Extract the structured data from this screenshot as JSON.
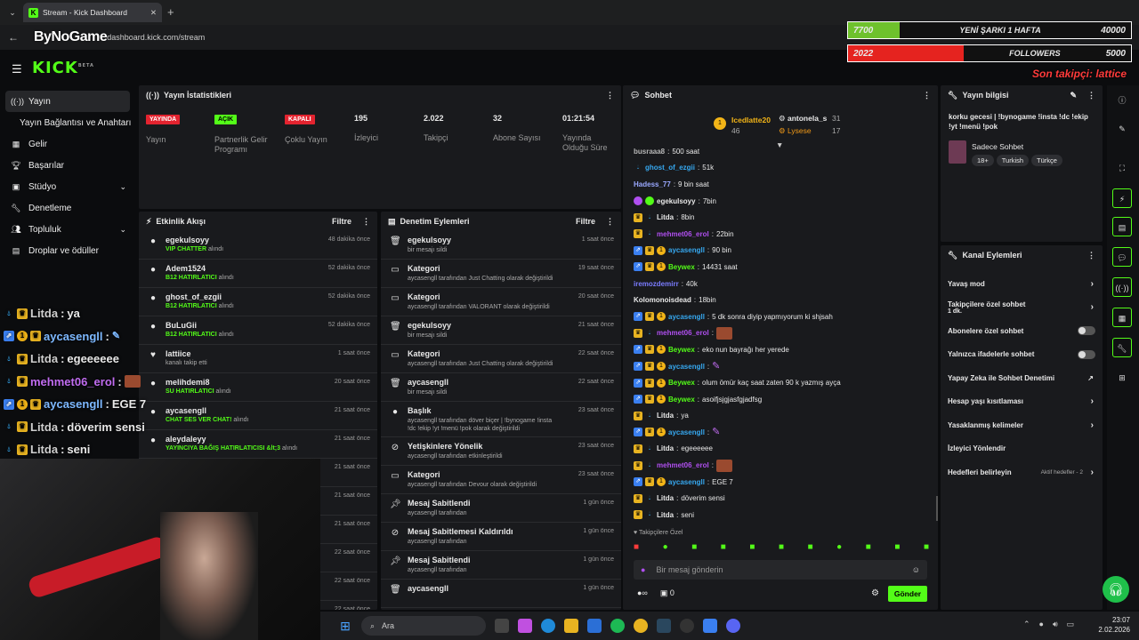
{
  "browser": {
    "tab_title": "Stream - Kick Dashboard",
    "url": "dashboard.kick.com/stream",
    "overlay_logo": "ByNoGame"
  },
  "overlay": {
    "bar1": {
      "current": "7700",
      "label": "YENİ ŞARKI 1 HAFTA",
      "goal": "40000"
    },
    "bar2": {
      "current": "2022",
      "label": "FOLLOWERS",
      "goal": "5000"
    },
    "last_follower": "Son takipçi: lattice"
  },
  "kick_logo": "KICK",
  "sidebar": {
    "items": [
      {
        "label": "Yayın",
        "icon": "broadcast-icon"
      },
      {
        "label": "Yayın Bağlantısı ve Anahtarı",
        "icon": ""
      },
      {
        "label": "Gelir",
        "icon": "chart-icon"
      },
      {
        "label": "Başarılar",
        "icon": "trophy-icon"
      },
      {
        "label": "Stüdyo",
        "icon": "grid-icon"
      },
      {
        "label": "Denetleme",
        "icon": "wrench-icon"
      },
      {
        "label": "Topluluk",
        "icon": "people-icon"
      },
      {
        "label": "Droplar ve ödüller",
        "icon": "gift-icon"
      }
    ]
  },
  "stats": {
    "title": "Yayın İstatistikleri",
    "items": [
      {
        "badge": "YAYINDA",
        "label": "Yayın"
      },
      {
        "badge": "AÇIK",
        "label": "Partnerlik Gelir Programı"
      },
      {
        "badge": "KAPALI",
        "label": "Çoklu Yayın"
      },
      {
        "value": "195",
        "label": "İzleyici"
      },
      {
        "value": "2.022",
        "label": "Takipçi"
      },
      {
        "value": "32",
        "label": "Abone Sayısı"
      },
      {
        "value": "01:21:54",
        "label": "Yayında Olduğu Süre"
      }
    ]
  },
  "activity": {
    "title": "Etkinlik Akışı",
    "filter": "Filtre",
    "rows": [
      {
        "name": "egekulsoyy",
        "hl": "VIP CHATTER",
        "rest": "alındı",
        "time": "48 dakika önce"
      },
      {
        "name": "Adem1524",
        "hl": "B12 HATIRLATICI",
        "rest": "alındı",
        "time": "52 dakika önce"
      },
      {
        "name": "ghost_of_ezgii",
        "hl": "B12 HATIRLATICI",
        "rest": "alındı",
        "time": "52 dakika önce"
      },
      {
        "name": "BuLuGii",
        "hl": "B12 HATIRLATICI",
        "rest": "alındı",
        "time": "52 dakika önce"
      },
      {
        "name": "lattiice",
        "hl": "",
        "rest": "kanalı takip etti",
        "time": "1 saat önce"
      },
      {
        "name": "melihdemi8",
        "hl": "SU HATIRLATICI",
        "rest": "alındı",
        "time": "20 saat önce"
      },
      {
        "name": "aycasengll",
        "hl": "CHAT SES VER CHAT!",
        "rest": "alındı",
        "time": "21 saat önce"
      },
      {
        "name": "aleydaleyy",
        "hl": "YAYINCIYA BAĞIŞ HATIRLATICISI &lt;3",
        "rest": "alındı",
        "time": "21 saat önce"
      },
      {
        "name": "",
        "hl": "",
        "rest": "",
        "time": "21 saat önce"
      },
      {
        "name": "",
        "hl": "",
        "rest": "",
        "time": "21 saat önce"
      },
      {
        "name": "",
        "hl": "",
        "rest": "",
        "time": "21 saat önce"
      },
      {
        "name": "",
        "hl": "",
        "rest": "",
        "time": "22 saat önce"
      },
      {
        "name": "",
        "hl": "",
        "rest": "",
        "time": "22 saat önce"
      },
      {
        "name": "",
        "hl": "",
        "rest": "",
        "time": "22 saat önce"
      }
    ]
  },
  "mod": {
    "title": "Denetim Eylemleri",
    "filter": "Filtre",
    "rows": [
      {
        "name": "egekulsoyy",
        "sub": "bir mesajı sildi",
        "time": "1 saat önce"
      },
      {
        "name": "Kategori",
        "sub": "aycasengll tarafından Just Chatting olarak değiştirildi",
        "time": "19 saat önce"
      },
      {
        "name": "Kategori",
        "sub": "aycasengll tarafından VALORANT olarak değiştirildi",
        "time": "20 saat önce"
      },
      {
        "name": "egekulsoyy",
        "sub": "bir mesajı sildi",
        "time": "21 saat önce"
      },
      {
        "name": "Kategori",
        "sub": "aycasengll tarafından Just Chatting olarak değiştirildi",
        "time": "22 saat önce"
      },
      {
        "name": "aycasengll",
        "sub": "bir mesajı sildi",
        "time": "22 saat önce"
      },
      {
        "name": "Başlık",
        "sub": "aycasengll tarafından döver biçer | !bynogame !insta !dc !ekip !yt !menü !pok olarak değiştirildi",
        "time": "23 saat önce"
      },
      {
        "name": "Yetişkinlere Yönelik",
        "sub": "aycasengll tarafından etkinleştirildi",
        "time": "23 saat önce"
      },
      {
        "name": "Kategori",
        "sub": "aycasengll tarafından Devour olarak değiştirildi",
        "time": "23 saat önce"
      },
      {
        "name": "Mesaj Sabitlendi",
        "sub": "aycasengll tarafından",
        "time": "1 gün önce"
      },
      {
        "name": "Mesaj Sabitlemesi Kaldırıldı",
        "sub": "aycasengll tarafından",
        "time": "1 gün önce"
      },
      {
        "name": "Mesaj Sabitlendi",
        "sub": "aycasengll tarafından",
        "time": "1 gün önce"
      },
      {
        "name": "aycasengll",
        "sub": "",
        "time": "1 gün önce"
      }
    ]
  },
  "chat": {
    "title": "Sohbet",
    "pins": {
      "p1": {
        "name": "Icedlatte20",
        "count": "46"
      },
      "p2": {
        "name": "antonela_s",
        "count": "31"
      },
      "p3": {
        "name": "Lysese",
        "count": "17"
      }
    },
    "messages": [
      {
        "user": "busraaa8",
        "color": "#b7b7b7",
        "text": "500 saat"
      },
      {
        "user": "ghost_of_ezgii",
        "color": "#36a8f0",
        "text": "51k"
      },
      {
        "user": "Hadess_77",
        "color": "#9aa8ff",
        "text": "9 bin saat"
      },
      {
        "user": "egekulsoyy",
        "color": "#e8e8e8",
        "text": "7bin"
      },
      {
        "user": "Litda",
        "color": "#e8e8e8",
        "text": "8bin"
      },
      {
        "user": "mehmet06_erol",
        "color": "#b04ff0",
        "text": "22bin"
      },
      {
        "user": "aycasengll",
        "color": "#36a8f0",
        "text": "90 bin"
      },
      {
        "user": "Beywex",
        "color": "#53fc18",
        "text": "14431 saat"
      },
      {
        "user": "iremozdemirr",
        "color": "#7a7cff",
        "text": "40k"
      },
      {
        "user": "Kolomonoisdead",
        "color": "#e8e8e8",
        "text": "18bin"
      },
      {
        "user": "aycasengll",
        "color": "#36a8f0",
        "text": "5 dk sonra diyip yapmıyorum ki shjsah"
      },
      {
        "user": "mehmet06_erol",
        "color": "#b04ff0",
        "text": ""
      },
      {
        "user": "Beywex",
        "color": "#53fc18",
        "text": "eko nun bayrağı her yerede"
      },
      {
        "user": "aycasengll",
        "color": "#36a8f0",
        "text": ""
      },
      {
        "user": "Beywex",
        "color": "#53fc18",
        "text": "olum ömür kaç saat zaten 90 k yazmış ayça"
      },
      {
        "user": "Beywex",
        "color": "#53fc18",
        "text": "asoifjsjgjasfgjadfsg"
      },
      {
        "user": "Litda",
        "color": "#e8e8e8",
        "text": "ya"
      },
      {
        "user": "aycasengll",
        "color": "#36a8f0",
        "text": ""
      },
      {
        "user": "Litda",
        "color": "#e8e8e8",
        "text": "egeeeeee"
      },
      {
        "user": "mehmet06_erol",
        "color": "#b04ff0",
        "text": ""
      },
      {
        "user": "aycasengll",
        "color": "#36a8f0",
        "text": "EGE 7"
      },
      {
        "user": "Litda",
        "color": "#e8e8e8",
        "text": "döverim sensi"
      },
      {
        "user": "Litda",
        "color": "#e8e8e8",
        "text": "seni"
      }
    ],
    "followers_only": "Takipçilere Özel",
    "placeholder": "Bir mesaj gönderin",
    "count": "0",
    "send": "Gönder"
  },
  "info": {
    "title": "Yayın bilgisi",
    "stream_title": "korku gecesi | !bynogame !insta !dc !ekip !yt !menü !pok",
    "category": "Sadece Sohbet",
    "tags": [
      "18+",
      "Turkish",
      "Türkçe"
    ]
  },
  "kanal": {
    "title": "Kanal Eylemleri",
    "items": [
      {
        "label": "Yavaş mod",
        "sub": "",
        "kind": "arrow"
      },
      {
        "label": "Takipçilere özel sohbet",
        "sub": "1 dk.",
        "kind": "arrow"
      },
      {
        "label": "Abonelere özel sohbet",
        "sub": "",
        "kind": "toggle"
      },
      {
        "label": "Yalnızca ifadelerle sohbet",
        "sub": "",
        "kind": "toggle"
      },
      {
        "label": "Yapay Zeka ile Sohbet Denetimi",
        "sub": "",
        "kind": "ext"
      },
      {
        "label": "Hesap yaşı kısıtlaması",
        "sub": "",
        "kind": "arrow"
      },
      {
        "label": "Yasaklanmış kelimeler",
        "sub": "",
        "kind": "arrow"
      },
      {
        "label": "İzleyici Yönlendir",
        "sub": "",
        "kind": "none"
      },
      {
        "label": "Hedefleri belirleyin",
        "sub": "Aktif hedefler - 2",
        "kind": "arrow"
      }
    ]
  },
  "overlay_chat": [
    {
      "user": "Litda",
      "text": "ya"
    },
    {
      "user": "aycasengll",
      "text": ""
    },
    {
      "user": "Litda",
      "text": "egeeeeee"
    },
    {
      "user": "mehmet06_erol",
      "text": ""
    },
    {
      "user": "aycasengll",
      "text": "EGE 7"
    },
    {
      "user": "Litda",
      "text": "döverim sensi"
    },
    {
      "user": "Litda",
      "text": "seni"
    }
  ],
  "taskbar": {
    "search": "Ara",
    "time": "23:07",
    "date": "2.02.2026"
  }
}
